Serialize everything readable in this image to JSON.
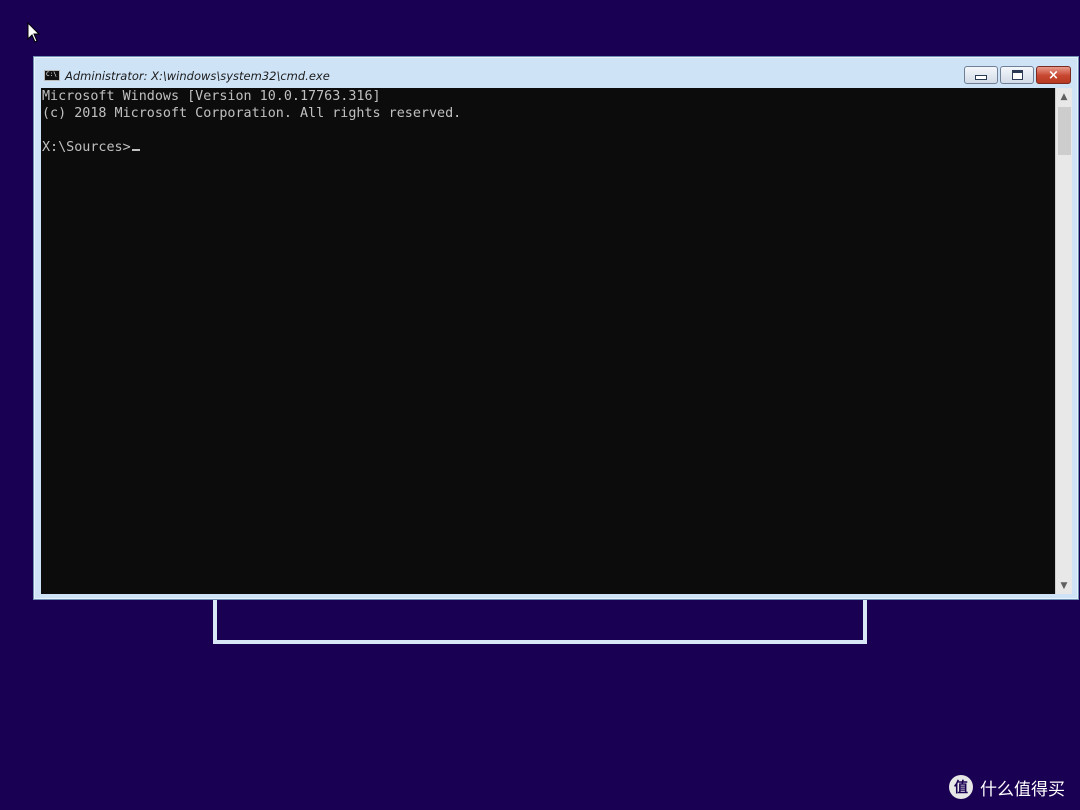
{
  "desktop": {
    "background_color": "#1a0052"
  },
  "window": {
    "title": "Administrator: X:\\windows\\system32\\cmd.exe",
    "icon_label": "C:\\",
    "buttons": {
      "minimize": "minimize-icon",
      "maximize": "maximize-icon",
      "close": "×"
    }
  },
  "console": {
    "lines": [
      "Microsoft Windows [Version 10.0.17763.316]",
      "(c) 2018 Microsoft Corporation. All rights reserved.",
      "",
      "X:\\Sources>"
    ],
    "text_color": "#c0c0c0",
    "background_color": "#0c0c0c"
  },
  "scrollbar": {
    "up_arrow": "▲",
    "down_arrow": "▼"
  },
  "watermark": {
    "logo": "值",
    "text": "什么值得买"
  }
}
